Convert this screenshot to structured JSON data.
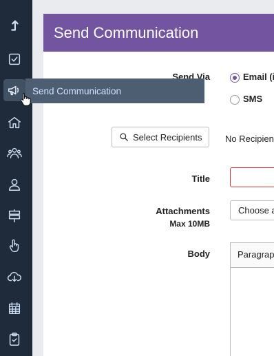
{
  "tooltip": {
    "text": "Send Communication"
  },
  "header": {
    "title": "Send Communication"
  },
  "form": {
    "send_via_label": "Send Via",
    "options": [
      {
        "label": "Email (i",
        "selected": true
      },
      {
        "label": "SMS",
        "selected": false
      }
    ],
    "select_recipients_label": "Select Recipients",
    "no_recipients_text": "No Recipien",
    "title_label": "Title",
    "attachments_label": "Attachments",
    "attachments_sub": "Max 10MB",
    "choose_file_label": "Choose a",
    "body_label": "Body",
    "paragraph_label": "Paragrap"
  },
  "colors": {
    "sidebar": "#1f2a3a",
    "header": "#7254a0",
    "tooltip": "#4d5e72",
    "error_border": "#dd3333"
  }
}
